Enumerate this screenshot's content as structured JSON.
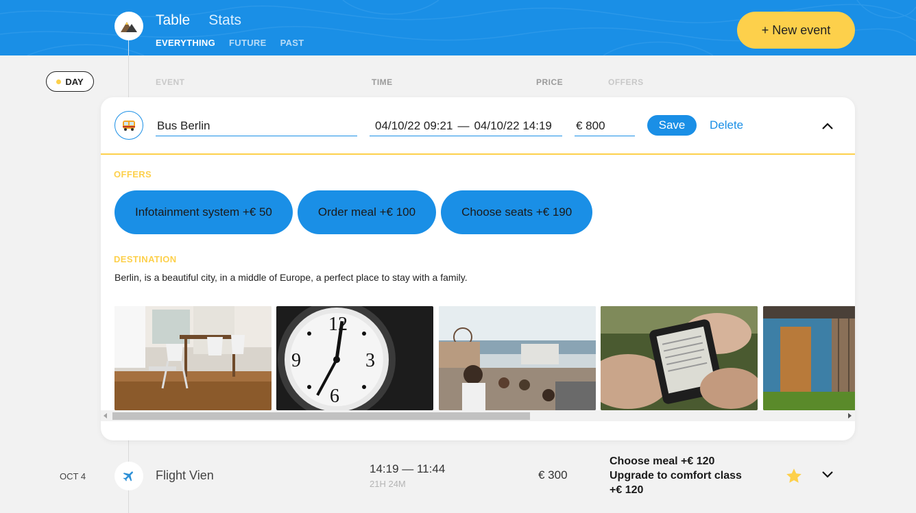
{
  "header": {
    "tabs": [
      {
        "label": "Table",
        "active": true
      },
      {
        "label": "Stats",
        "active": false
      }
    ],
    "filters": [
      {
        "label": "EVERYTHING",
        "active": true
      },
      {
        "label": "FUTURE",
        "active": false
      },
      {
        "label": "PAST",
        "active": false
      }
    ],
    "new_event_label": "+ New event",
    "colors": {
      "primary": "#1a8fe6",
      "accent": "#fdd04b"
    }
  },
  "sort": {
    "day_label": "DAY",
    "columns": [
      "EVENT",
      "TIME",
      "PRICE",
      "OFFERS"
    ]
  },
  "edit_form": {
    "type_icon": "bus-icon",
    "destination_value": "Bus Berlin",
    "start_time": "04/10/22 09:21",
    "time_separator": "—",
    "end_time": "04/10/22 14:19",
    "price_value": "€ 800",
    "save_label": "Save",
    "delete_label": "Delete",
    "offers_title": "OFFERS",
    "offers": [
      "Infotainment system +€  50",
      "Order meal +€  100",
      "Choose seats +€  190"
    ],
    "destination_title": "DESTINATION",
    "destination_description": "Berlin, is a beautiful city, in a middle of Europe, a perfect place to stay with a family."
  },
  "events": [
    {
      "date": "OCT 4",
      "type_icon": "plane-icon",
      "name": "Flight Vien",
      "time": "14:19 — 11:44",
      "duration": "21H 24M",
      "price": "€ 300",
      "offers": [
        "Choose meal +€  120",
        "Upgrade to comfort class +€  120"
      ],
      "favorite": true
    }
  ]
}
